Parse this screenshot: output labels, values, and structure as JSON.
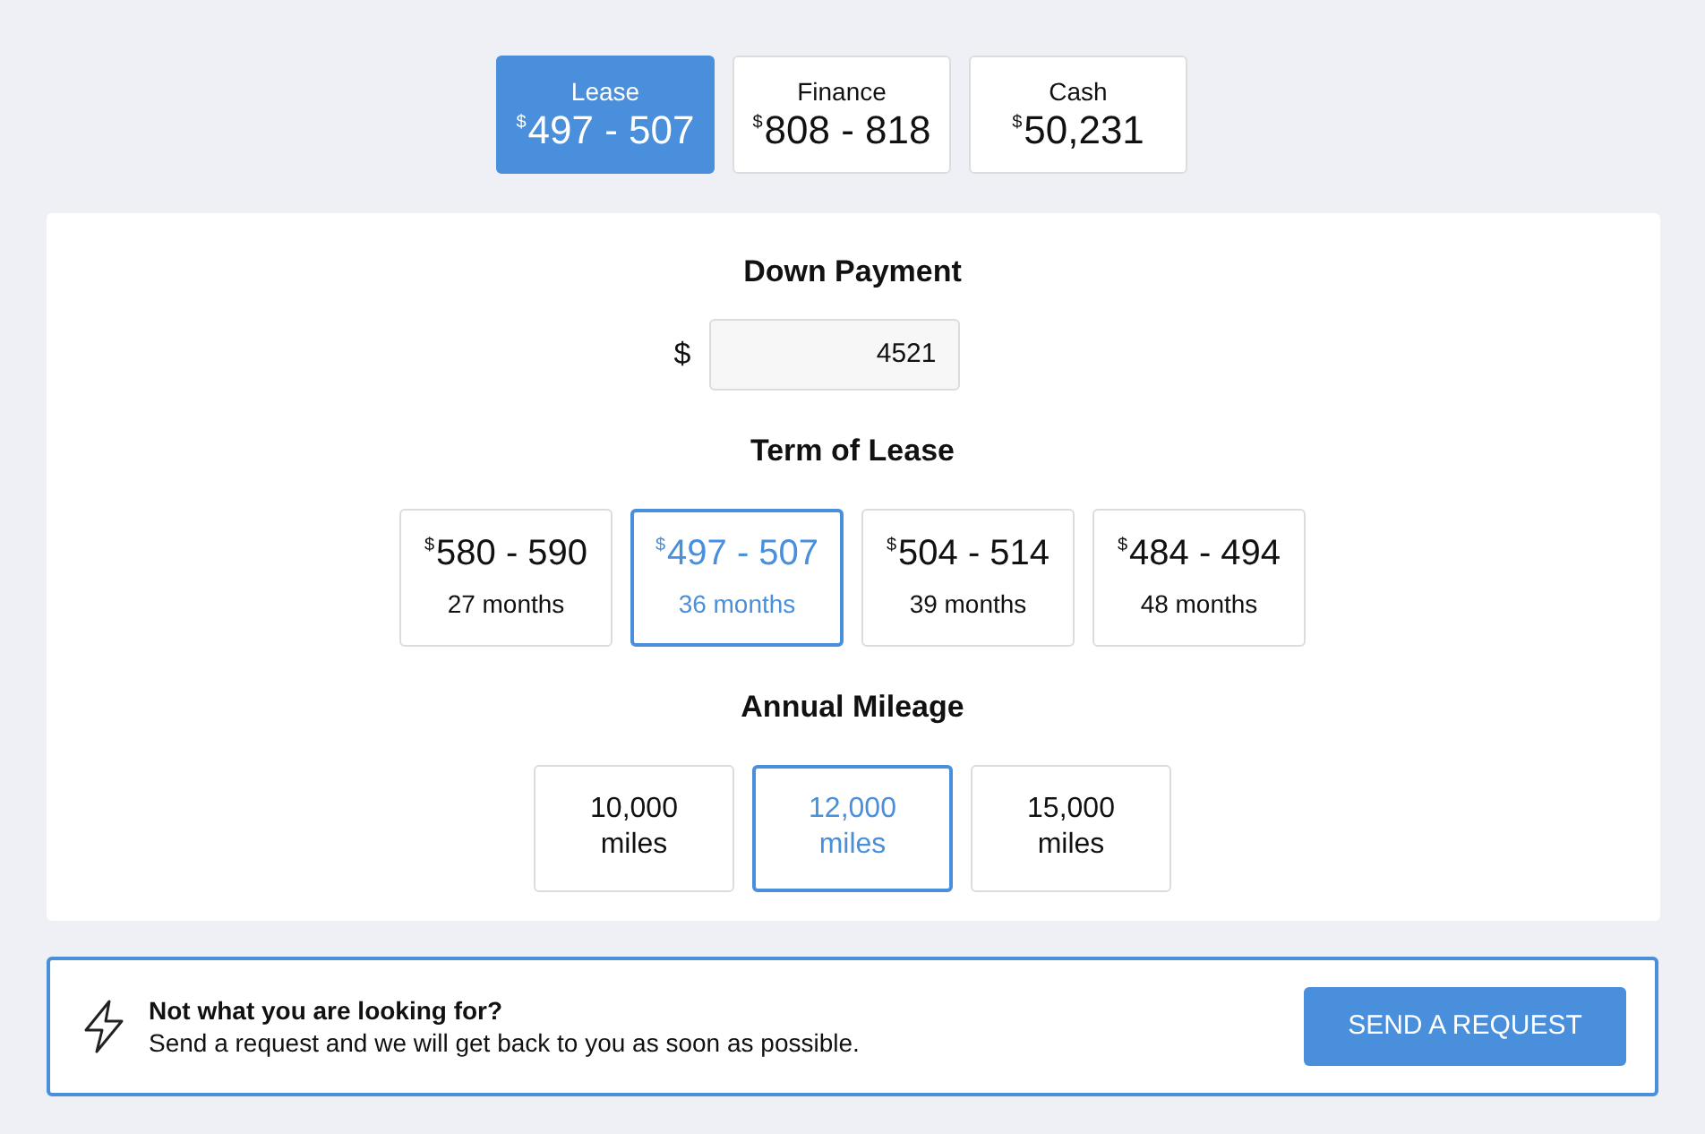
{
  "payment_tabs": [
    {
      "label": "Lease",
      "currency": "$",
      "amount": "497 - 507",
      "selected": true
    },
    {
      "label": "Finance",
      "currency": "$",
      "amount": "808 - 818",
      "selected": false
    },
    {
      "label": "Cash",
      "currency": "$",
      "amount": "50,231",
      "selected": false
    }
  ],
  "down_payment": {
    "title": "Down Payment",
    "currency": "$",
    "value": "4521"
  },
  "term": {
    "title": "Term of Lease",
    "options": [
      {
        "currency": "$",
        "amount": "580 - 590",
        "label": "27 months",
        "selected": false
      },
      {
        "currency": "$",
        "amount": "497 - 507",
        "label": "36 months",
        "selected": true
      },
      {
        "currency": "$",
        "amount": "504 - 514",
        "label": "39 months",
        "selected": false
      },
      {
        "currency": "$",
        "amount": "484 - 494",
        "label": "48 months",
        "selected": false
      }
    ]
  },
  "mileage": {
    "title": "Annual Mileage",
    "options": [
      {
        "label": "10,000 miles",
        "selected": false
      },
      {
        "label": "12,000 miles",
        "selected": true
      },
      {
        "label": "15,000 miles",
        "selected": false
      }
    ]
  },
  "request_banner": {
    "heading": "Not what you are looking for?",
    "text": "Send a request and we will get back to you as soon as possible.",
    "button": "SEND A REQUEST"
  }
}
